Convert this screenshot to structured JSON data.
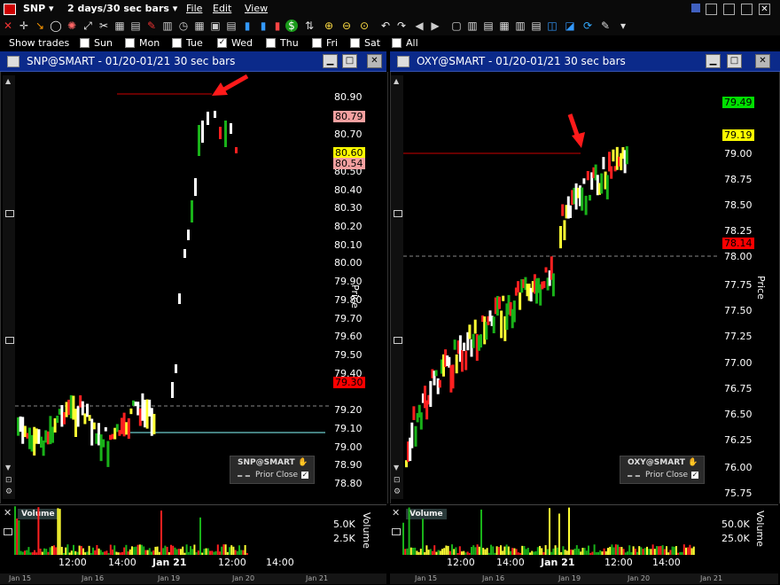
{
  "menu": {
    "symbol": "SNP",
    "interval": "2 days/30 sec bars",
    "items": [
      "File",
      "Edit",
      "View"
    ]
  },
  "show_trades": {
    "label": "Show trades",
    "days": [
      {
        "label": "Sun",
        "checked": false
      },
      {
        "label": "Mon",
        "checked": false
      },
      {
        "label": "Tue",
        "checked": false
      },
      {
        "label": "Wed",
        "checked": true
      },
      {
        "label": "Thu",
        "checked": false
      },
      {
        "label": "Fri",
        "checked": false
      },
      {
        "label": "Sat",
        "checked": false
      },
      {
        "label": "All",
        "checked": false
      }
    ]
  },
  "left_window": {
    "title": "SNP@SMART - 01/20-01/21 30 sec bars",
    "price_axis_label": "Price",
    "volume_axis_label": "Volume",
    "price_ticks": [
      "80.90",
      "80.70",
      "80.50",
      "80.40",
      "80.30",
      "80.20",
      "80.10",
      "80.00",
      "79.90",
      "79.80",
      "79.70",
      "79.60",
      "79.50",
      "79.40",
      "79.20",
      "79.10",
      "79.00",
      "78.90",
      "78.80"
    ],
    "badges": [
      {
        "text": "80.79",
        "color": "#f4a0a0"
      },
      {
        "text": "80.60",
        "color": "#ffff00"
      },
      {
        "text": "80.54",
        "color": "#f4a0a0"
      },
      {
        "text": "79.30",
        "color": "#ff0000"
      }
    ],
    "legend_symbol": "SNP@SMART",
    "legend_prior": "Prior Close",
    "volume_label": "Volume",
    "volume_ticks": [
      "5.0K",
      "2.5K"
    ],
    "time_ticks": [
      "12:00",
      "14:00",
      "Jan 21",
      "12:00",
      "14:00"
    ],
    "strip_labels": [
      "Jan 15",
      "Jan 16",
      "Jan 19",
      "Jan 20",
      "Jan 21"
    ],
    "accent": "#ff0000"
  },
  "right_window": {
    "title": "OXY@SMART - 01/20-01/21 30 sec bars",
    "price_axis_label": "Price",
    "volume_axis_label": "Volume",
    "price_ticks": [
      "79.00",
      "78.75",
      "78.50",
      "78.25",
      "78.00",
      "77.75",
      "77.50",
      "77.25",
      "77.00",
      "76.75",
      "76.50",
      "76.25",
      "76.00",
      "75.75"
    ],
    "badges": [
      {
        "text": "79.49",
        "color": "#00e000"
      },
      {
        "text": "79.19",
        "color": "#ffff00"
      },
      {
        "text": "78.14",
        "color": "#ff0000"
      }
    ],
    "legend_symbol": "OXY@SMART",
    "legend_prior": "Prior Close",
    "volume_label": "Volume",
    "volume_ticks": [
      "50.0K",
      "25.0K"
    ],
    "time_ticks": [
      "12:00",
      "14:00",
      "Jan 21",
      "12:00",
      "14:00"
    ],
    "strip_labels": [
      "Jan 15",
      "Jan 16",
      "Jan 19",
      "Jan 20",
      "Jan 21"
    ]
  },
  "icons": [
    "chart-type-icon",
    "crosshair-icon",
    "draw-icon",
    "circle-icon",
    "settings-icon",
    "trendline-icon",
    "scissors-icon",
    "bar-chart-icon",
    "dollar-icon",
    "zoom-in-icon",
    "zoom-out-icon",
    "undo-icon",
    "redo-icon",
    "select-icon",
    "grid-icon",
    "compare-icon",
    "link-icon",
    "refresh-icon",
    "wrench-icon"
  ]
}
